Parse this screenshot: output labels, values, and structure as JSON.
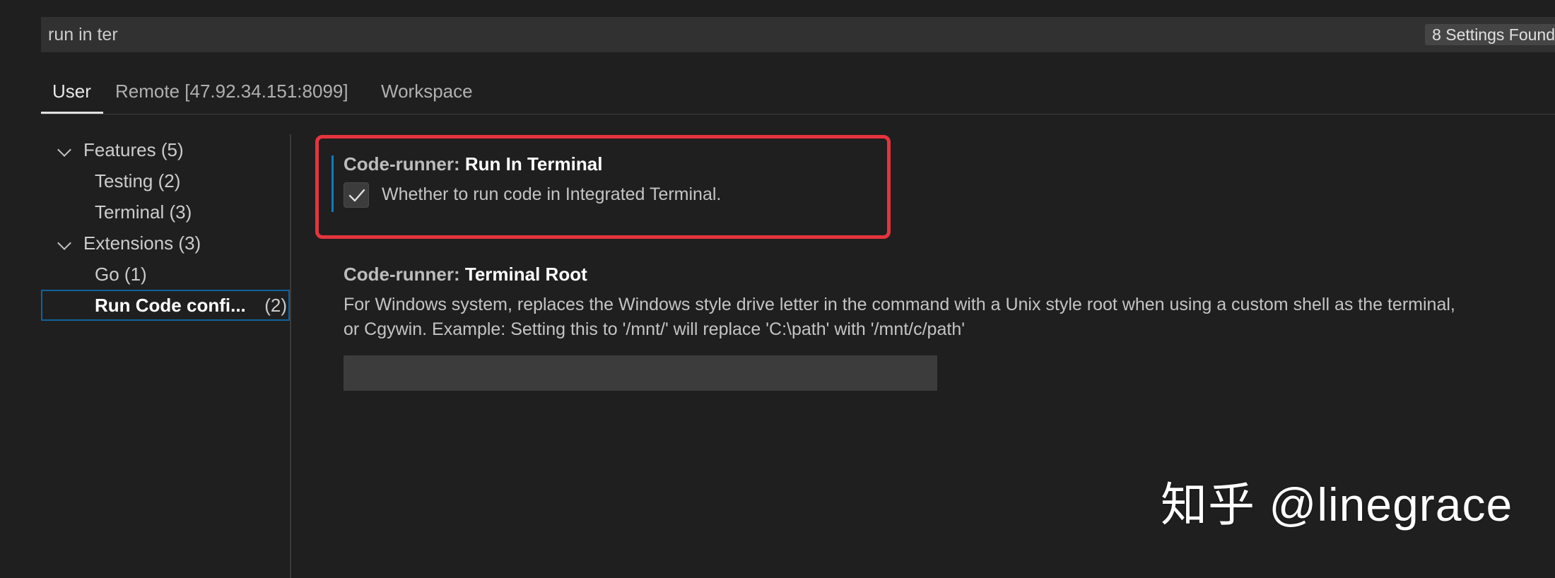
{
  "search": {
    "value": "run in ter",
    "results_badge": "8 Settings Found"
  },
  "tabs": [
    {
      "label": "User",
      "active": true
    },
    {
      "label": "Remote [47.92.34.151:8099]",
      "active": false
    },
    {
      "label": "Workspace",
      "active": false
    }
  ],
  "toc": {
    "features": {
      "label": "Features (5)"
    },
    "testing": {
      "label": "Testing (2)"
    },
    "terminal": {
      "label": "Terminal (3)"
    },
    "extensions": {
      "label": "Extensions (3)"
    },
    "go": {
      "label": "Go (1)"
    },
    "run_code": {
      "label": "Run Code confi...",
      "count": "(2)"
    }
  },
  "settings": {
    "run_in_terminal": {
      "category": "Code-runner: ",
      "name": "Run In Terminal",
      "description": "Whether to run code in Integrated Terminal.",
      "checked": true
    },
    "terminal_root": {
      "category": "Code-runner: ",
      "name": "Terminal Root",
      "description_line1": "For Windows system, replaces the Windows style drive letter in the command with a Unix style root when using a custom shell as the terminal,",
      "description_line2": "or Cgywin. Example: Setting this to '/mnt/' will replace 'C:\\path' with '/mnt/c/path'",
      "value": ""
    }
  },
  "watermark": {
    "text": "知乎 @linegrace"
  },
  "colors": {
    "background": "#1f1f1f",
    "highlight_border": "#e5343e",
    "focus_accent": "#0e7cc3",
    "selection_border": "#0e639c"
  }
}
